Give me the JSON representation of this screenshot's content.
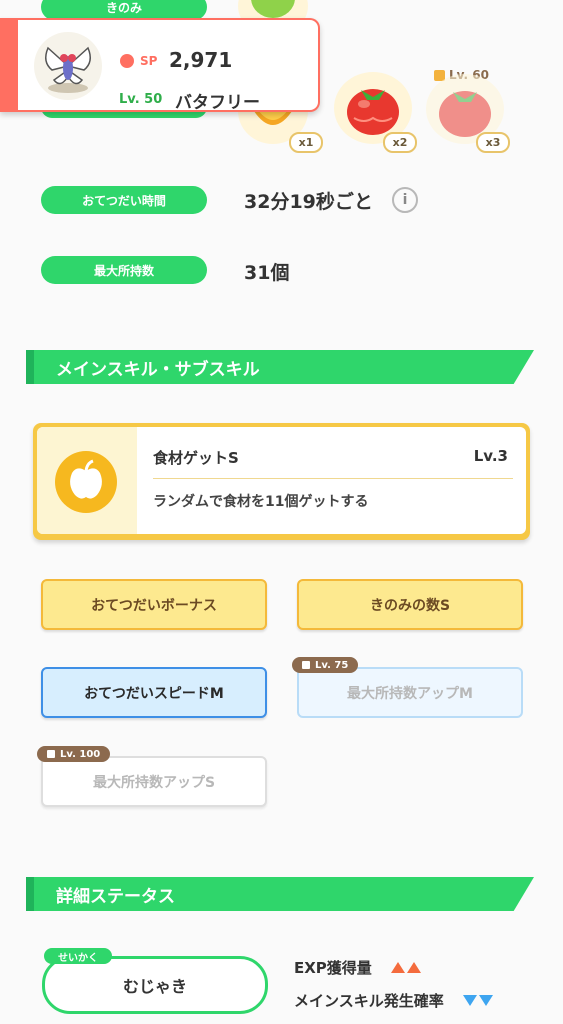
{
  "pokemon": {
    "sp_label": "SP",
    "sp_value": "2,971",
    "level_label": "Lv. 50",
    "name": "バタフリー"
  },
  "stats": {
    "berry_label": "きのみ",
    "helping_time_label": "おてつだい時間",
    "helping_time_value": "32分19秒ごと",
    "max_carry_label": "最大所持数",
    "max_carry_value": "31個"
  },
  "ingredients": [
    {
      "icon": "honey-icon",
      "count": "x1"
    },
    {
      "icon": "tomato-icon",
      "count": "x2"
    },
    {
      "icon": "tomato-icon",
      "count": "x3",
      "unlock_level": "Lv. 60"
    }
  ],
  "skill_section": {
    "title": "メインスキル・サブスキル",
    "main_skill": {
      "name": "食材ゲットS",
      "level": "Lv.3",
      "description": "ランダムで食材を11個ゲットする"
    },
    "sub_skills": [
      {
        "label": "おてつだいボーナス",
        "style": "gold"
      },
      {
        "label": "きのみの数S",
        "style": "gold"
      },
      {
        "label": "おてつだいスピードM",
        "style": "blue"
      },
      {
        "label": "最大所持数アップM",
        "style": "blue-locked",
        "unlock": "Lv. 75"
      },
      {
        "label": "最大所持数アップS",
        "style": "white-locked",
        "unlock": "Lv. 100"
      }
    ]
  },
  "detail_section": {
    "title": "詳細ステータス",
    "nature_tag": "せいかく",
    "nature": "むじゃき",
    "effects": [
      {
        "label": "EXP獲得量",
        "direction": "up",
        "color": "#f46b3d"
      },
      {
        "label": "メインスキル発生確率",
        "direction": "down",
        "color": "#3ea5f0"
      }
    ]
  }
}
